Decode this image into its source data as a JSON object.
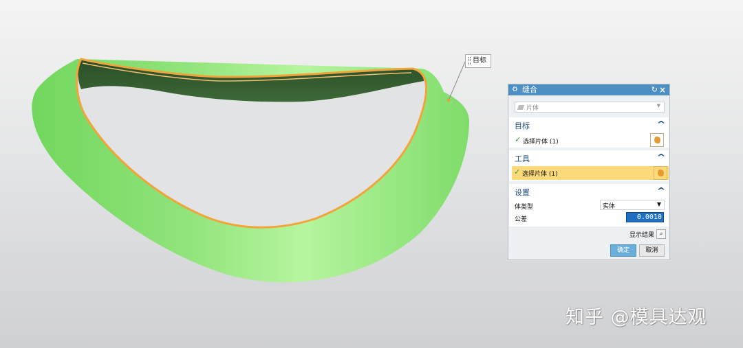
{
  "viewport": {
    "target_label": "目标",
    "colors": {
      "surface": "#8fe37a",
      "edge": "#f2a33a",
      "inner": "#2f5a2c"
    }
  },
  "dialog": {
    "title": "缝合",
    "reset_icon": "reset-icon",
    "close_icon": "close-icon",
    "type_value": "片体",
    "sections": {
      "target": {
        "title": "目标",
        "select_label": "选择片体 (1)"
      },
      "tool": {
        "title": "工具",
        "select_label": "选择片体 (1)"
      },
      "settings": {
        "title": "设置",
        "body_type_label": "体类型",
        "body_type_value": "实体",
        "tolerance_label": "公差",
        "tolerance_value": "0.0010"
      }
    },
    "show_result_label": "显示结果",
    "ok_label": "确定",
    "cancel_label": "取消",
    "colors": {
      "titlebar": "#4e8fc3",
      "section_title": "#1f4f86",
      "highlight": "#fcd97a"
    }
  },
  "watermark": "知乎 @模具达观"
}
